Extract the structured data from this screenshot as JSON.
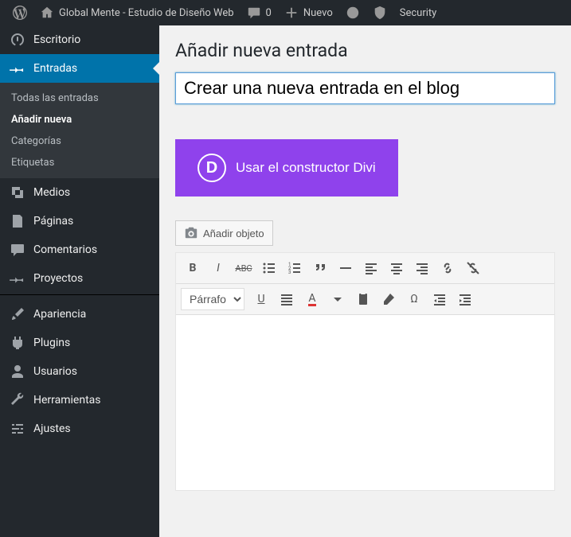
{
  "topbar": {
    "site_name": "Global Mente - Estudio de Diseño Web",
    "comments_count": "0",
    "new_label": "Nuevo",
    "security_label": "Security"
  },
  "sidebar": {
    "dashboard": "Escritorio",
    "posts": "Entradas",
    "posts_submenu": {
      "all": "Todas las entradas",
      "new": "Añadir nueva",
      "categories": "Categorías",
      "tags": "Etiquetas"
    },
    "media": "Medios",
    "pages": "Páginas",
    "comments": "Comentarios",
    "projects": "Proyectos",
    "appearance": "Apariencia",
    "plugins": "Plugins",
    "users": "Usuarios",
    "tools": "Herramientas",
    "settings": "Ajustes"
  },
  "page": {
    "heading": "Añadir nueva entrada",
    "title_value": "Crear una nueva entrada en el blog",
    "divi_label": "Usar el constructor Divi",
    "add_media_label": "Añadir objeto",
    "format_select": "Párrafo"
  }
}
